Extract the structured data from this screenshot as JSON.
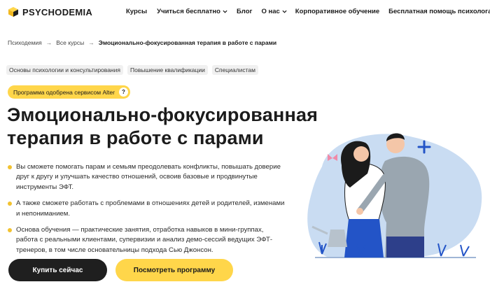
{
  "header": {
    "brand": "PSYCHODEMIA",
    "nav": [
      {
        "label": "Курсы",
        "has_dropdown": false
      },
      {
        "label": "Учиться бесплатно",
        "has_dropdown": true
      },
      {
        "label": "Блог",
        "has_dropdown": false
      },
      {
        "label": "О нас",
        "has_dropdown": true
      },
      {
        "label": "Корпоративное обучение",
        "has_dropdown": false
      },
      {
        "label": "Бесплатная помощь психолога",
        "has_dropdown": false
      }
    ]
  },
  "breadcrumb": {
    "items": [
      "Психодемия",
      "Все курсы"
    ],
    "separator": "→",
    "current": "Эмоционально-фокусированная терапия в работе с парами"
  },
  "tags": [
    "Основы психологии и консультирования",
    "Повышение квалификации",
    "Специалистам"
  ],
  "badge": {
    "text": "Программа одобрена сервисом Alter",
    "help": "?"
  },
  "title": "Эмоционально-фокусированная терапия в работе с парами",
  "bullets": [
    "Вы сможете помогать парам и семьям преодолевать конфликты, повышать доверие друг к другу и улучшать качество отношений, освоив базовые и продвинутые инструменты ЭФТ.",
    "А также сможете работать с проблемами в отношениях детей и родителей, изменами и непониманием.",
    "Основа обучения — практические занятия, отработка навыков в мини-группах, работа с реальными клиентами, супервизии и анализ демо-сессий ведущих ЭФТ-тренеров, в том числе основательницы подхода Сью Джонсон."
  ],
  "buttons": {
    "buy": "Купить сейчас",
    "view": "Посмотреть программу"
  },
  "colors": {
    "accent": "#ffd64a",
    "dark": "#1f1f1f",
    "blob": "#c9dcf2",
    "bullet": "#f2c230"
  },
  "icons": {
    "logo": "psychodemia-cube-logo",
    "dropdown": "chevron-down-icon"
  }
}
